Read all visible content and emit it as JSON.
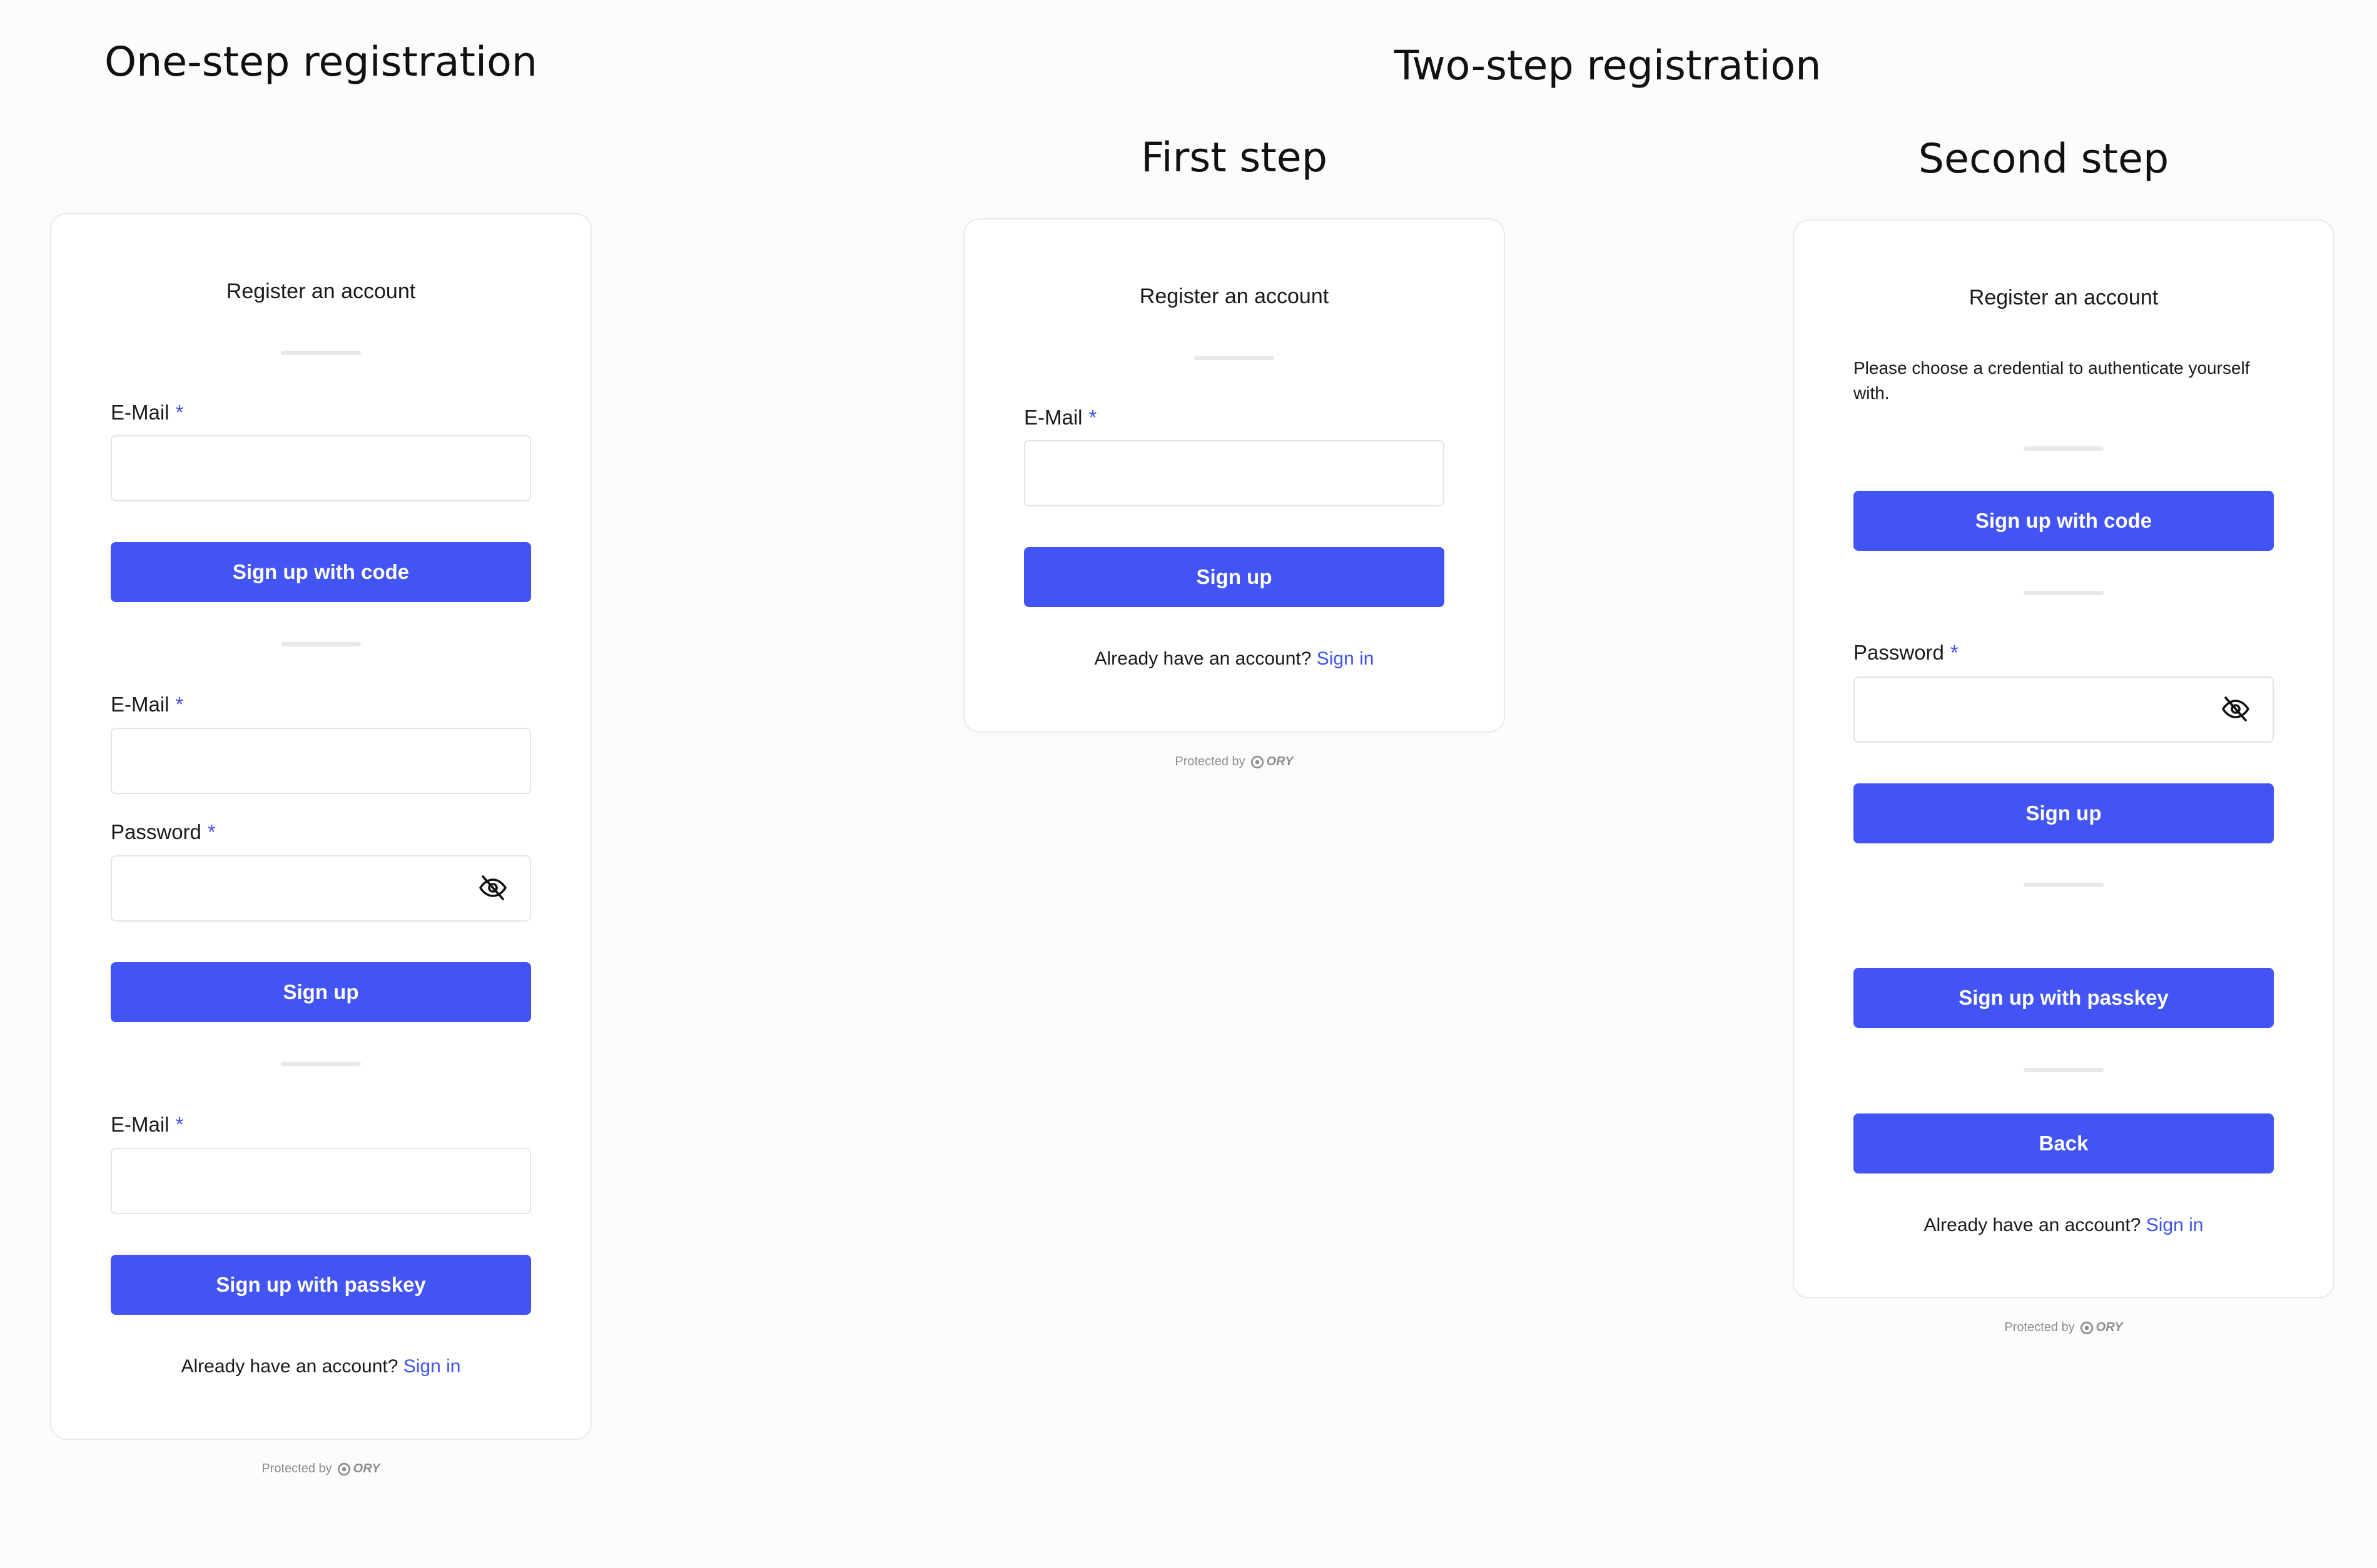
{
  "headings": {
    "one_step": "One-step registration",
    "two_step": "Two-step registration",
    "first_step": "First step",
    "second_step": "Second step"
  },
  "card_title": "Register an account",
  "labels": {
    "email": "E-Mail",
    "password": "Password",
    "required_marker": "*"
  },
  "buttons": {
    "sign_up_with_code": "Sign up with code",
    "sign_up": "Sign up",
    "sign_up_with_passkey": "Sign up with passkey",
    "back": "Back"
  },
  "footer": {
    "already_have_account": "Already have an account?",
    "sign_in": "Sign in",
    "protected_by": "Protected by",
    "brand": "ORY"
  },
  "second_step_description": "Please choose a credential to authenticate yourself with.",
  "colors": {
    "accent": "#4254f4",
    "link": "#3f54f0",
    "card_border": "#e9e9ec"
  },
  "icons": {
    "password_toggle": "eye-off-icon",
    "brand_logo": "ory-logo-icon"
  }
}
